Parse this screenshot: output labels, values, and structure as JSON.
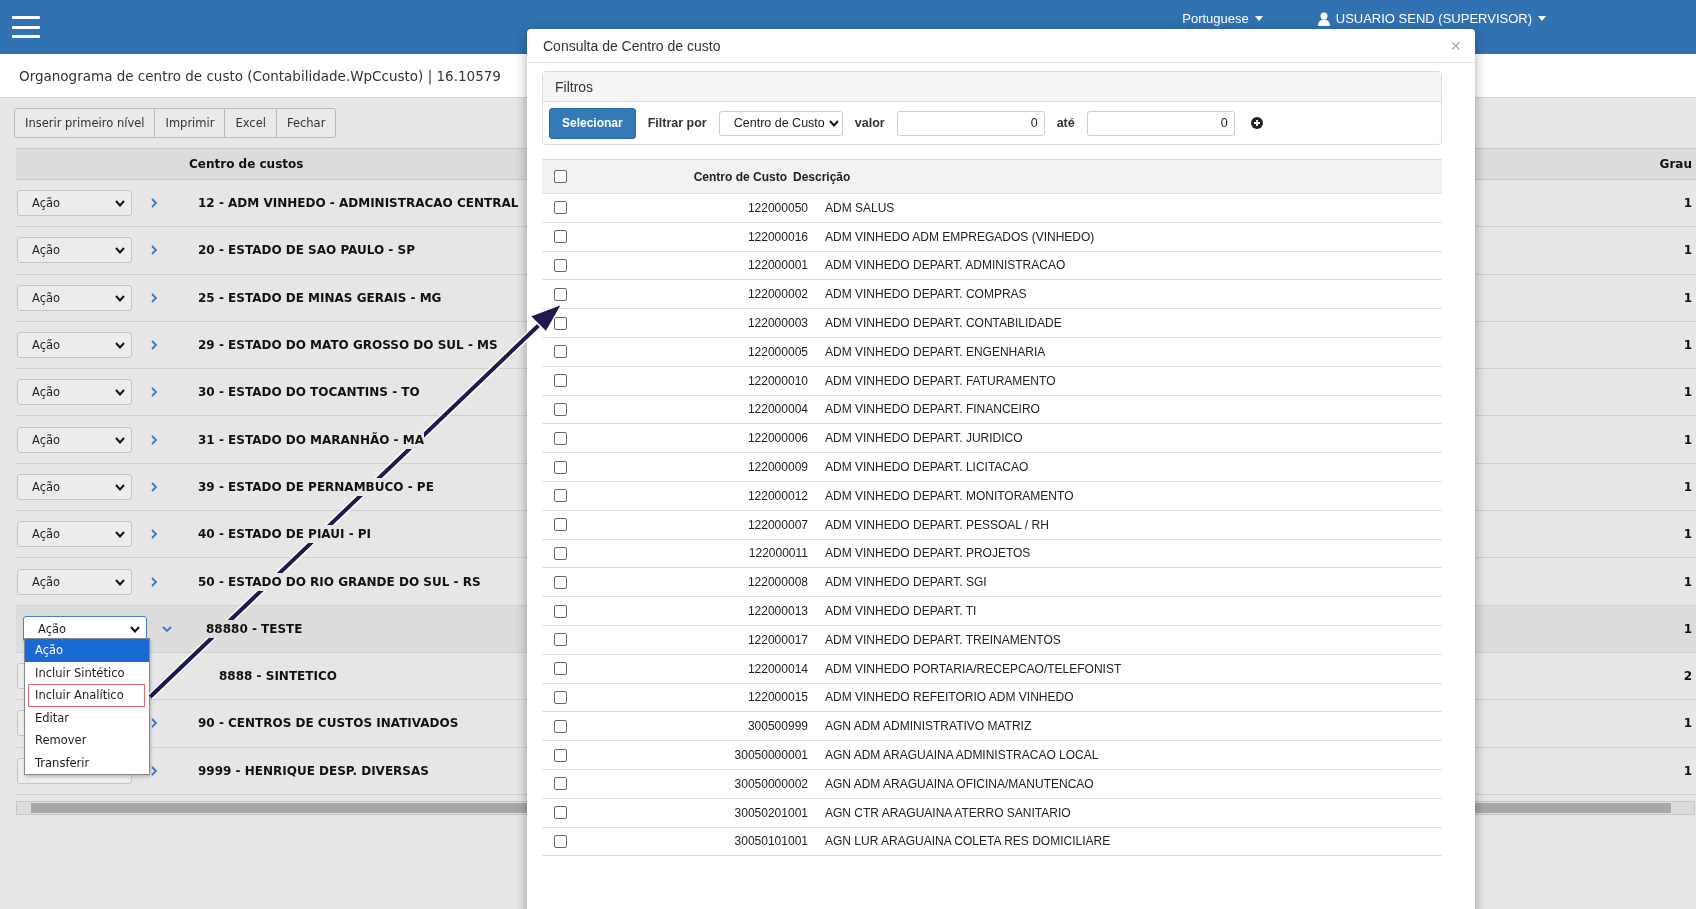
{
  "topbar": {
    "language": "Portuguese",
    "user": "USUARIO SEND (SUPERVISOR)"
  },
  "page_title": "Organograma de centro de custo (Contabilidade.WpCcusto) | 16.10579",
  "toolbar": [
    "Inserir primeiro nível",
    "Imprimir",
    "Excel",
    "Fechar"
  ],
  "tree": {
    "columns": [
      "Centro de custos",
      "Grau"
    ],
    "rows": [
      {
        "action": "Ação",
        "label": "12 - ADM VINHEDO - ADMINISTRACAO CENTRAL",
        "grau": "1",
        "expanded": false
      },
      {
        "action": "Ação",
        "label": "20 - ESTADO DE SAO PAULO - SP",
        "grau": "1",
        "expanded": false
      },
      {
        "action": "Ação",
        "label": "25 - ESTADO DE MINAS GERAIS - MG",
        "grau": "1",
        "expanded": false
      },
      {
        "action": "Ação",
        "label": "29 - ESTADO DO MATO GROSSO DO SUL - MS",
        "grau": "1",
        "expanded": false
      },
      {
        "action": "Ação",
        "label": "30 - ESTADO DO TOCANTINS - TO",
        "grau": "1",
        "expanded": false
      },
      {
        "action": "Ação",
        "label": "31 - ESTADO DO MARANHÃO - MA",
        "grau": "1",
        "expanded": false
      },
      {
        "action": "Ação",
        "label": "39 - ESTADO DE PERNAMBUCO - PE",
        "grau": "1",
        "expanded": false
      },
      {
        "action": "Ação",
        "label": "40 - ESTADO DE PIAUI - PI",
        "grau": "1",
        "expanded": false
      },
      {
        "action": "Ação",
        "label": "50 - ESTADO DO RIO GRANDE DO SUL - RS",
        "grau": "1",
        "expanded": false
      },
      {
        "action": "Ação",
        "label": "88880 - TESTE",
        "grau": "1",
        "expanded": true,
        "menu_open": true,
        "children": [
          {
            "label": "8888 - SINTETICO",
            "grau": "2"
          }
        ]
      },
      {
        "label": "90 - CENTROS DE CUSTOS INATIVADOS",
        "grau": "1",
        "expanded": false
      },
      {
        "label": "9999 - HENRIQUE DESP. DIVERSAS",
        "grau": "1",
        "expanded": false
      }
    ]
  },
  "action_menu": [
    {
      "label": "Ação",
      "selected": true,
      "outlined": false
    },
    {
      "label": "Incluir Sintético",
      "selected": false,
      "outlined": false
    },
    {
      "label": "Incluir Analítico",
      "selected": false,
      "outlined": true
    },
    {
      "label": "Editar",
      "selected": false,
      "outlined": false
    },
    {
      "label": "Remover",
      "selected": false,
      "outlined": false
    },
    {
      "label": "Transferir",
      "selected": false,
      "outlined": false
    }
  ],
  "modal": {
    "title": "Consulta de Centro de custo",
    "close": "×",
    "filters": {
      "title": "Filtros",
      "button": "Selecionar",
      "filter_label": "Filtrar por",
      "filter_by": "Centro de Custo",
      "value_label": "valor",
      "value_from": "0",
      "to_label": "até",
      "value_to": "0"
    },
    "columns": [
      "Centro de Custo",
      "Descrição"
    ],
    "all_checked": false,
    "rows": [
      {
        "code": "122000050",
        "description": "ADM SALUS",
        "checked": false
      },
      {
        "code": "122000016",
        "description": "ADM VINHEDO ADM EMPREGADOS (VINHEDO)",
        "checked": false
      },
      {
        "code": "122000001",
        "description": "ADM VINHEDO DEPART. ADMINISTRACAO",
        "checked": false
      },
      {
        "code": "122000002",
        "description": "ADM VINHEDO DEPART. COMPRAS",
        "checked": false
      },
      {
        "code": "122000003",
        "description": "ADM VINHEDO DEPART. CONTABILIDADE",
        "checked": false
      },
      {
        "code": "122000005",
        "description": "ADM VINHEDO DEPART. ENGENHARIA",
        "checked": false
      },
      {
        "code": "122000010",
        "description": "ADM VINHEDO DEPART. FATURAMENTO",
        "checked": false
      },
      {
        "code": "122000004",
        "description": "ADM VINHEDO DEPART. FINANCEIRO",
        "checked": false
      },
      {
        "code": "122000006",
        "description": "ADM VINHEDO DEPART. JURIDICO",
        "checked": false
      },
      {
        "code": "122000009",
        "description": "ADM VINHEDO DEPART. LICITACAO",
        "checked": false
      },
      {
        "code": "122000012",
        "description": "ADM VINHEDO DEPART. MONITORAMENTO",
        "checked": false
      },
      {
        "code": "122000007",
        "description": "ADM VINHEDO DEPART. PESSOAL / RH",
        "checked": false
      },
      {
        "code": "122000011",
        "description": "ADM VINHEDO DEPART. PROJETOS",
        "checked": false
      },
      {
        "code": "122000008",
        "description": "ADM VINHEDO DEPART. SGI",
        "checked": false
      },
      {
        "code": "122000013",
        "description": "ADM VINHEDO DEPART. TI",
        "checked": false
      },
      {
        "code": "122000017",
        "description": "ADM VINHEDO DEPART. TREINAMENTOS",
        "checked": false
      },
      {
        "code": "122000014",
        "description": "ADM VINHEDO PORTARIA/RECEPCAO/TELEFONIST",
        "checked": false
      },
      {
        "code": "122000015",
        "description": "ADM VINHEDO REFEITORIO ADM VINHEDO",
        "checked": false
      },
      {
        "code": "300500999",
        "description": "AGN ADM ADMINISTRATIVO MATRIZ",
        "checked": false
      },
      {
        "code": "30050000001",
        "description": "AGN ADM ARAGUAINA ADMINISTRACAO LOCAL",
        "checked": false
      },
      {
        "code": "30050000002",
        "description": "AGN ADM ARAGUAINA OFICINA/MANUTENCAO",
        "checked": false
      },
      {
        "code": "30050201001",
        "description": "AGN CTR ARAGUAINA ATERRO SANITARIO",
        "checked": false
      },
      {
        "code": "30050101001",
        "description": "AGN LUR ARAGUAINA COLETA RES DOMICILIARE",
        "checked": false
      }
    ]
  }
}
